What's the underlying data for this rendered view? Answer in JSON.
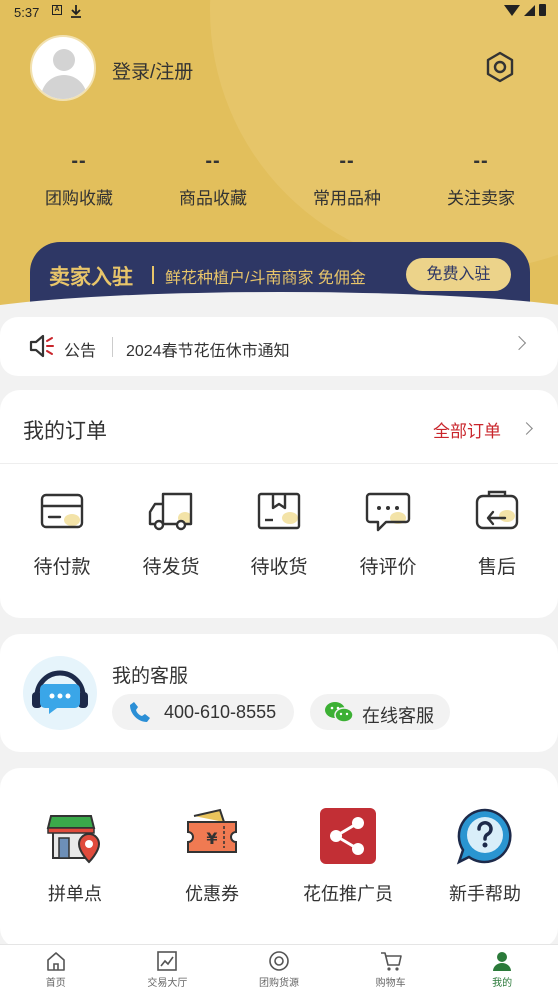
{
  "status_bar": {
    "time": "5:37"
  },
  "profile": {
    "login_label": "登录/注册"
  },
  "stats": [
    {
      "value": "--",
      "label": "团购收藏"
    },
    {
      "value": "--",
      "label": "商品收藏"
    },
    {
      "value": "--",
      "label": "常用品种"
    },
    {
      "value": "--",
      "label": "关注卖家"
    }
  ],
  "seller_banner": {
    "title": "卖家入驻",
    "description": "鲜花种植户/斗南商家 免佣金",
    "button_label": "免费入驻"
  },
  "notice": {
    "label": "公告",
    "text": "2024春节花伍休市通知"
  },
  "orders": {
    "title": "我的订单",
    "all_label": "全部订单",
    "items": [
      {
        "label": "待付款",
        "icon": "wallet-card-icon"
      },
      {
        "label": "待发货",
        "icon": "truck-icon"
      },
      {
        "label": "待收货",
        "icon": "package-box-icon"
      },
      {
        "label": "待评价",
        "icon": "chat-review-icon"
      },
      {
        "label": "售后",
        "icon": "return-icon"
      }
    ]
  },
  "service": {
    "title": "我的客服",
    "phone": "400-610-8555",
    "online_label": "在线客服"
  },
  "tools": [
    {
      "label": "拼单点",
      "icon": "shop-location-icon"
    },
    {
      "label": "优惠券",
      "icon": "coupon-icon"
    },
    {
      "label": "花伍推广员",
      "icon": "share-icon"
    },
    {
      "label": "新手帮助",
      "icon": "help-icon"
    }
  ],
  "bottom_nav": [
    {
      "label": "首页",
      "icon": "home-icon"
    },
    {
      "label": "交易大厅",
      "icon": "trade-chart-icon"
    },
    {
      "label": "团购货源",
      "icon": "group-buy-icon"
    },
    {
      "label": "购物车",
      "icon": "cart-icon"
    },
    {
      "label": "我的",
      "icon": "user-icon",
      "active": true
    }
  ],
  "colors": {
    "header": "#e2bf5c",
    "banner_bg": "#2e3765",
    "banner_text": "#e8c56a",
    "accent_red": "#c9252b",
    "active_nav": "#2b7a3a"
  }
}
